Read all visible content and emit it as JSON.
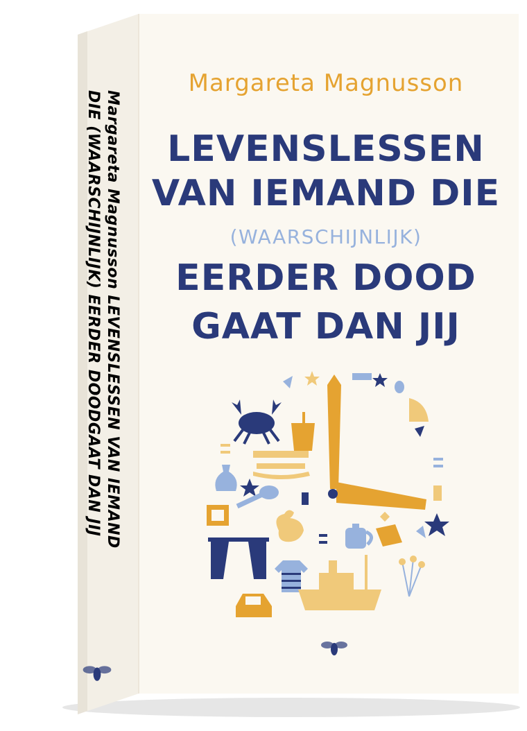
{
  "spine": {
    "author": "Margareta Magnusson",
    "title_part1": "LEVENSLESSEN VAN IEMAND",
    "title_part2": "DIE (WAARSCHIJNLIJK) EERDER DOODGAAT DAN JIJ"
  },
  "cover": {
    "author": "Margareta Magnusson",
    "title_line1": "LEVENSLESSEN",
    "title_line2": "VAN IEMAND DIE",
    "subtitle": "(WAARSCHIJNLIJK)",
    "title_line3": "EERDER DOOD",
    "title_line4": "GAAT DAN JIJ"
  },
  "colors": {
    "navy": "#2a3a7a",
    "orange": "#e5a331",
    "light_blue": "#97b2dd",
    "sand": "#f0c97a",
    "cover_bg": "#fbf8f1"
  },
  "icons": [
    "crab-icon",
    "bucket-icon",
    "sled-icon",
    "vase-icon",
    "star-icon",
    "spoon-icon",
    "frame-icon",
    "chicken-icon",
    "curtain-icon",
    "teapot-icon",
    "sweater-icon",
    "ship-icon",
    "car-icon",
    "flowers-icon",
    "clock-hand-icon",
    "bee-logo-icon"
  ]
}
